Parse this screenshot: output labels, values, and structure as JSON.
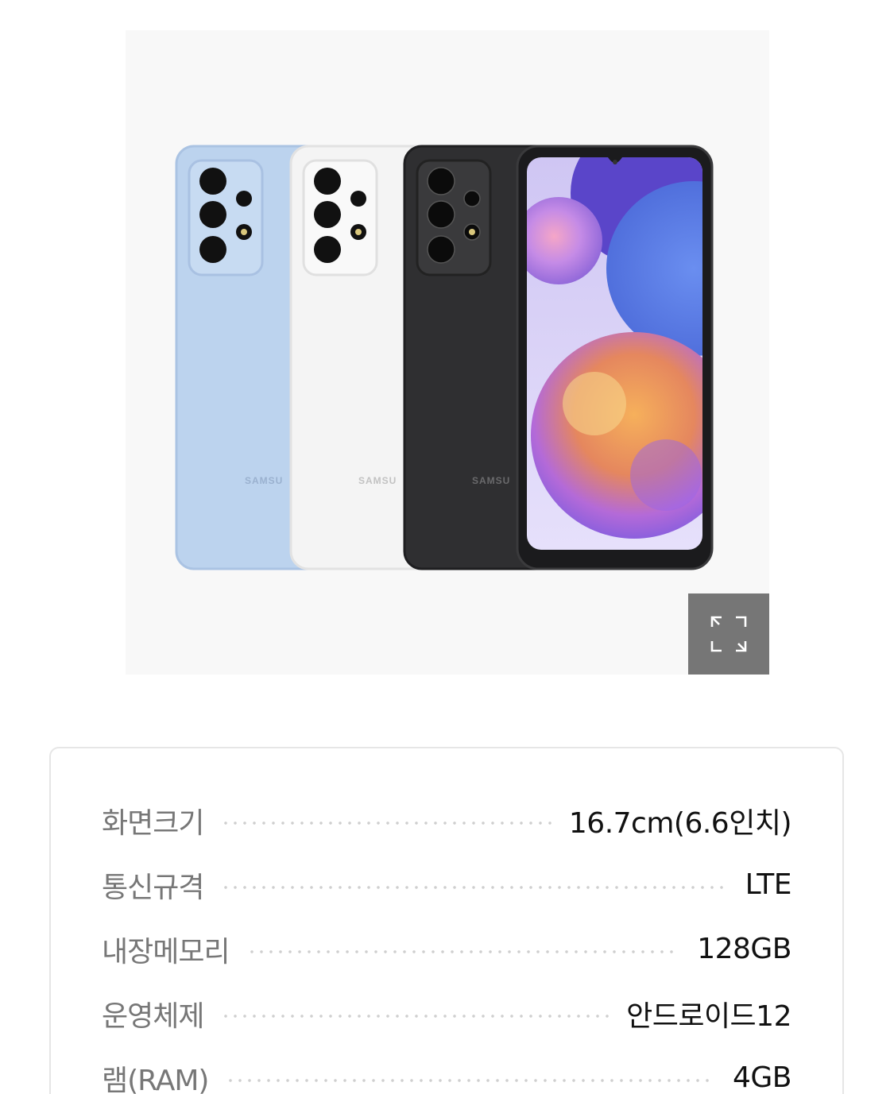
{
  "product_image": {
    "alt": "",
    "phone_colors": [
      "#bcd3ee",
      "#f4f4f4",
      "#2f2f31"
    ],
    "brand_text": "SAMSUNG",
    "expand_icon": "expand-icon"
  },
  "specs": [
    {
      "label": "화면크기",
      "value": "16.7cm(6.6인치)"
    },
    {
      "label": "통신규격",
      "value": "LTE"
    },
    {
      "label": "내장메모리",
      "value": "128GB"
    },
    {
      "label": "운영체제",
      "value": "안드로이드12"
    },
    {
      "label": "램(RAM)",
      "value": "4GB"
    }
  ]
}
